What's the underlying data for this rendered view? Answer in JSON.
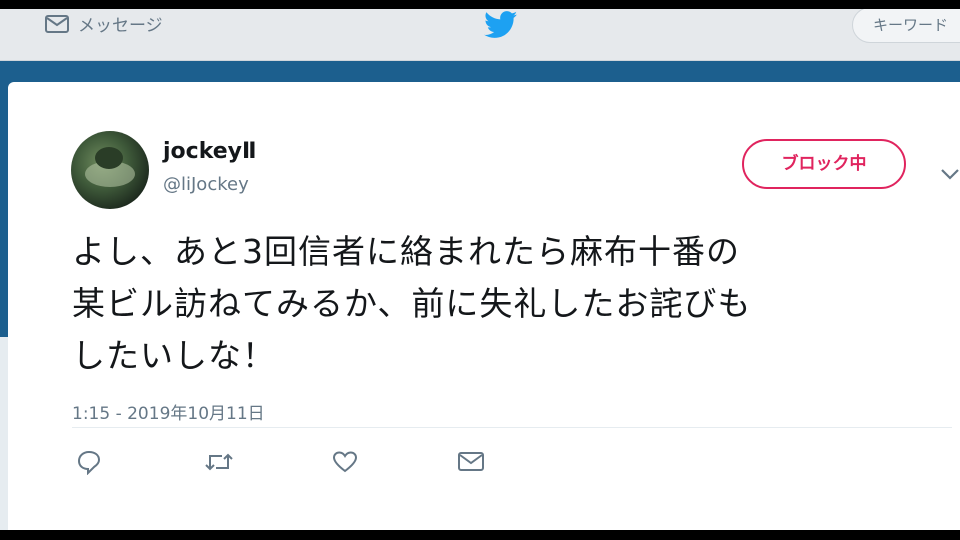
{
  "topbar": {
    "messages_label": "メッセージ",
    "search_placeholder": "キーワード"
  },
  "tweet": {
    "display_name": "jockeyⅡ",
    "handle": "@liJockey",
    "block_button_label": "ブロック中",
    "text": "よし、あと3回信者に絡まれたら麻布十番の\n某ビル訪ねてみるか、前に失礼したお詫びも\nしたいしな！",
    "timestamp": "1:15 - 2019年10月11日"
  },
  "icons": {
    "messages": "envelope-icon",
    "brand": "twitter-bird-icon",
    "more": "chevron-down-icon",
    "reply": "reply-icon",
    "retweet": "retweet-icon",
    "like": "heart-icon",
    "dm": "envelope-icon"
  },
  "colors": {
    "brand_blue": "#1da1f2",
    "block_red": "#e0245e",
    "secondary_text": "#657786"
  }
}
